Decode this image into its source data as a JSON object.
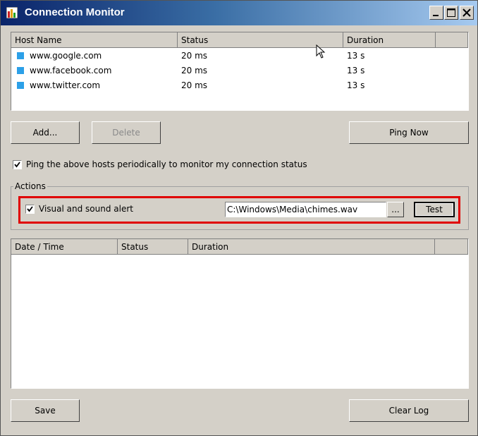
{
  "window": {
    "title": "Connection Monitor"
  },
  "titlebar": {
    "minimize_icon": "minimize-icon",
    "maximize_icon": "maximize-icon",
    "close_icon": "close-icon"
  },
  "hosts_table": {
    "columns": [
      "Host Name",
      "Status",
      "Duration"
    ],
    "rows": [
      {
        "host": "www.google.com",
        "status": "20 ms",
        "duration": "13 s"
      },
      {
        "host": "www.facebook.com",
        "status": "20 ms",
        "duration": "13 s"
      },
      {
        "host": "www.twitter.com",
        "status": "20 ms",
        "duration": "13 s"
      }
    ],
    "row_icon_color": "#2ca0e8"
  },
  "buttons": {
    "add": "Add...",
    "delete": "Delete",
    "ping_now": "Ping Now",
    "save": "Save",
    "clear_log": "Clear Log",
    "browse": "...",
    "test": "Test"
  },
  "periodic_ping": {
    "label": "Ping the above hosts periodically to monitor my connection status",
    "checked": true
  },
  "actions": {
    "title": "Actions",
    "alert_label": "Visual and sound alert",
    "alert_checked": true,
    "sound_file": "C:\\Windows\\Media\\chimes.wav"
  },
  "log_table": {
    "columns": [
      "Date / Time",
      "Status",
      "Duration"
    ]
  },
  "colors": {
    "highlight": "#e00000",
    "title_start": "#0a246a",
    "title_end": "#a6caf0"
  }
}
